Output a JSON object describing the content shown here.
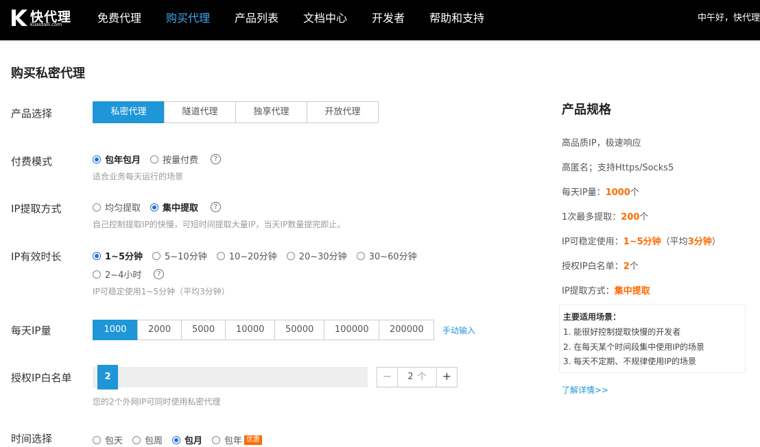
{
  "header": {
    "logo_text": "快代理",
    "logo_sub": "kuaidaili.com",
    "nav": [
      "免费代理",
      "购买代理",
      "产品列表",
      "文档中心",
      "开发者",
      "帮助和支持"
    ],
    "active_nav": 1,
    "greeting": "中午好，快代理"
  },
  "page_title": "购买私密代理",
  "product": {
    "label": "产品选择",
    "tabs": [
      "私密代理",
      "隧道代理",
      "独享代理",
      "开放代理"
    ],
    "active": 0
  },
  "payment": {
    "label": "付费模式",
    "options": [
      "包年包月",
      "按量付费"
    ],
    "selected": 0,
    "help": "?",
    "hint": "适合业务每天运行的场景"
  },
  "extraction": {
    "label": "IP提取方式",
    "options": [
      "均匀提取",
      "集中提取"
    ],
    "selected": 1,
    "help": "?",
    "hint": "自己控制提取IP的快慢，可短时间提取大量IP，当天IP数量提完即止。"
  },
  "validity": {
    "label": "IP有效时长",
    "options": [
      "1~5分钟",
      "5~10分钟",
      "10~20分钟",
      "20~30分钟",
      "30~60分钟",
      "2~4小时"
    ],
    "selected": 0,
    "help": "?",
    "hint": "IP可稳定使用1~5分钟（平均3分钟）"
  },
  "daily_ip": {
    "label": "每天IP量",
    "options": [
      "1000",
      "2000",
      "5000",
      "10000",
      "50000",
      "100000",
      "200000"
    ],
    "selected": 0,
    "manual": "手动输入"
  },
  "whitelist": {
    "label": "授权IP白名单",
    "value": "2",
    "minus": "−",
    "plus": "+",
    "unit": "个",
    "hint": "您的2个外网IP可同时使用私密代理"
  },
  "period": {
    "label": "时间选择",
    "options": [
      "包天",
      "包周",
      "包月",
      "包年"
    ],
    "selected": 2,
    "promo": "优惠"
  },
  "spec": {
    "title": "产品规格",
    "line1": "高品质IP，极速响应",
    "line2": "高匿名；支持Https/Socks5",
    "daily_label": "每天IP量：",
    "daily_value": "1000",
    "daily_unit": "个",
    "max_label": "1次最多提取：",
    "max_value": "200",
    "max_unit": "个",
    "stable_label": "IP可稳定使用：",
    "stable_value": "1~5分钟",
    "stable_mid": "（平均",
    "stable_avg": "3分钟",
    "stable_end": "）",
    "wl_label": "授权IP白名单：",
    "wl_value": "2",
    "wl_unit": "个",
    "mode_label": "IP提取方式：",
    "mode_value": "集中提取",
    "scenario_title": "主要适用场景：",
    "scenarios": [
      "1. 能很好控制提取快慢的开发者",
      "2. 在每天某个时间段集中使用IP的场景",
      "3. 每天不定期、不规律使用IP的场景"
    ],
    "more": "了解详情>>"
  },
  "colors": {
    "primary": "#1f96d8",
    "highlight": "#ff6a00",
    "nav_active": "#3fa9f5"
  }
}
